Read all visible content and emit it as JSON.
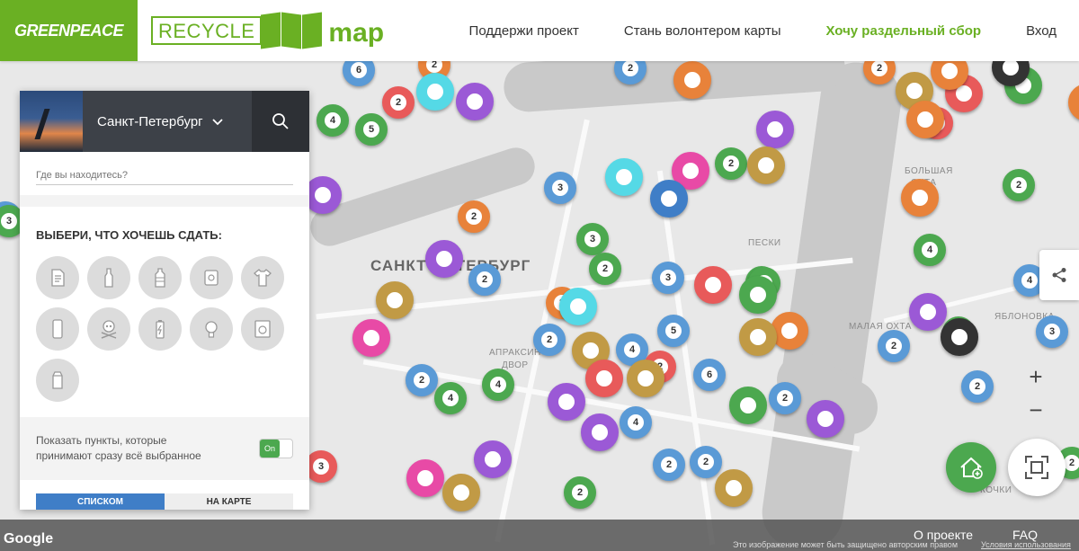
{
  "header": {
    "greenpeace_logo": "GREENPEACE",
    "recycle_logo": "RECYCLE",
    "map_logo": "map",
    "nav": [
      {
        "label": "Поддержи проект",
        "active": false
      },
      {
        "label": "Стань волонтером карты",
        "active": false
      },
      {
        "label": "Хочу раздельный сбор",
        "active": true
      },
      {
        "label": "Вход",
        "active": false
      }
    ]
  },
  "sidebar": {
    "city": "Санкт-Петербург",
    "chevron_icon": "chevron-down-icon",
    "search_icon": "search-icon",
    "location_placeholder": "Где вы находитесь?",
    "choose_title": "ВЫБЕРИ, ЧТО ХОЧЕШЬ СДАТЬ:",
    "categories": [
      {
        "icon": "paper-icon"
      },
      {
        "icon": "glass-bottle-icon"
      },
      {
        "icon": "plastic-bottle-icon"
      },
      {
        "icon": "metal-can-icon"
      },
      {
        "icon": "clothes-icon"
      },
      {
        "icon": "phone-icon"
      },
      {
        "icon": "hazardous-icon"
      },
      {
        "icon": "battery-icon"
      },
      {
        "icon": "lightbulb-icon"
      },
      {
        "icon": "appliance-icon"
      },
      {
        "icon": "tetra-pak-icon"
      }
    ],
    "toggle_text_line1": "Показать пункты, которые",
    "toggle_text_line2": "принимают сразу всё выбранное",
    "toggle_state": "On",
    "tabs": [
      "СПИСКОМ",
      "НА КАРТЕ"
    ]
  },
  "map": {
    "city_label": "САНКТ-ПЕТЕРБУРГ",
    "labels": [
      "ПЕСКИ",
      "АПРАКСИН",
      "ДВОР",
      "БОЛЬШАЯ",
      "ОХТА",
      "МАЛАЯ ОХТА",
      "ЯБЛОНОВКА",
      "КОЧКИ"
    ],
    "marker_counts": [
      "6",
      "2",
      "2",
      "4",
      "5",
      "2",
      "3",
      "2",
      "2",
      "3",
      "2",
      "2",
      "3",
      "2",
      "2",
      "4",
      "2",
      "2",
      "4",
      "5",
      "2",
      "3",
      "4",
      "2",
      "2",
      "3",
      "2",
      "4",
      "4",
      "6",
      "4",
      "2",
      "2",
      "2",
      "2",
      "3",
      "2",
      "2",
      "2",
      "2",
      "3",
      "2"
    ],
    "controls": {
      "share_icon": "share-icon",
      "zoom_in": "+",
      "zoom_out": "−",
      "add_point_icon": "add-home-icon",
      "fullscreen_icon": "fullscreen-icon"
    }
  },
  "footer": {
    "google": "Google",
    "about": "О проекте",
    "faq": "FAQ",
    "copyright": "Это изображение может быть защищено авторским правом",
    "terms": "Условия использования"
  }
}
